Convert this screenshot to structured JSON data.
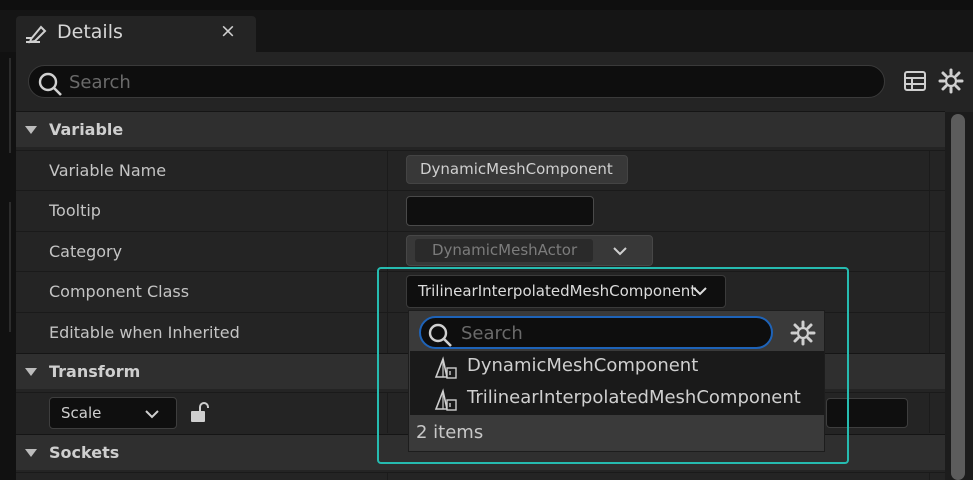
{
  "tab": {
    "title": "Details",
    "close_glyph": "×",
    "icon": "edit-pencil-icon"
  },
  "search": {
    "placeholder": "Search"
  },
  "toolbar": {
    "table_icon": "table-view-icon",
    "settings_icon": "gear-icon"
  },
  "categories": {
    "variable": "Variable",
    "transform": "Transform",
    "sockets": "Sockets"
  },
  "rows": {
    "variable_name": {
      "label": "Variable Name",
      "value": "DynamicMeshComponent"
    },
    "tooltip": {
      "label": "Tooltip",
      "value": ""
    },
    "category": {
      "label": "Category",
      "value": "DynamicMeshActor"
    },
    "component_class": {
      "label": "Component Class",
      "value": "TrilinearInterpolatedMeshComponent"
    },
    "editable_inherited": {
      "label": "Editable when Inherited"
    }
  },
  "transform": {
    "mode": "Scale",
    "lock_icon": "unlock-icon"
  },
  "dropdown": {
    "search_placeholder": "Search",
    "items": [
      {
        "label": "DynamicMeshComponent",
        "icon": "mesh-component-icon"
      },
      {
        "label": "TrilinearInterpolatedMeshComponent",
        "icon": "mesh-component-icon"
      }
    ],
    "count_text": "2 items"
  },
  "colors": {
    "focus": "#26bbb0",
    "search_focus": "#1e63b8",
    "panel": "#242424"
  }
}
